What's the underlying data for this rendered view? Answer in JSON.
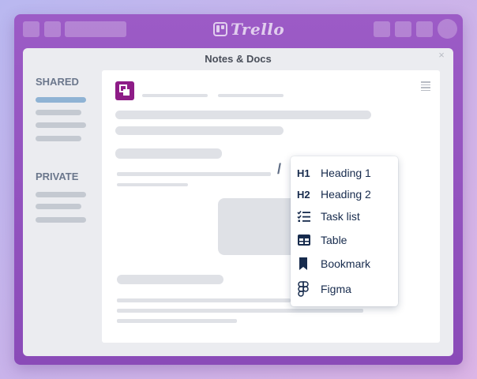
{
  "app": {
    "logo_text": "Trello"
  },
  "modal": {
    "title": "Notes & Docs",
    "close_glyph": "×"
  },
  "sidebar": {
    "shared_label": "SHARED",
    "private_label": "PRIVATE"
  },
  "editor": {
    "slash_command": "/"
  },
  "dropdown": {
    "items": [
      {
        "icon_text": "H1",
        "icon": "heading-1-icon",
        "label": "Heading 1"
      },
      {
        "icon_text": "H2",
        "icon": "heading-2-icon",
        "label": "Heading 2"
      },
      {
        "icon": "task-list-icon",
        "label": "Task list"
      },
      {
        "icon": "table-icon",
        "label": "Table"
      },
      {
        "icon": "bookmark-icon",
        "label": "Bookmark"
      },
      {
        "icon": "figma-icon",
        "label": "Figma"
      }
    ]
  },
  "colors": {
    "frame": "#9c5bc6",
    "doc_icon": "#8e1c87",
    "accent_bar": "#8fb3d4",
    "text_dark": "#172b4d"
  }
}
